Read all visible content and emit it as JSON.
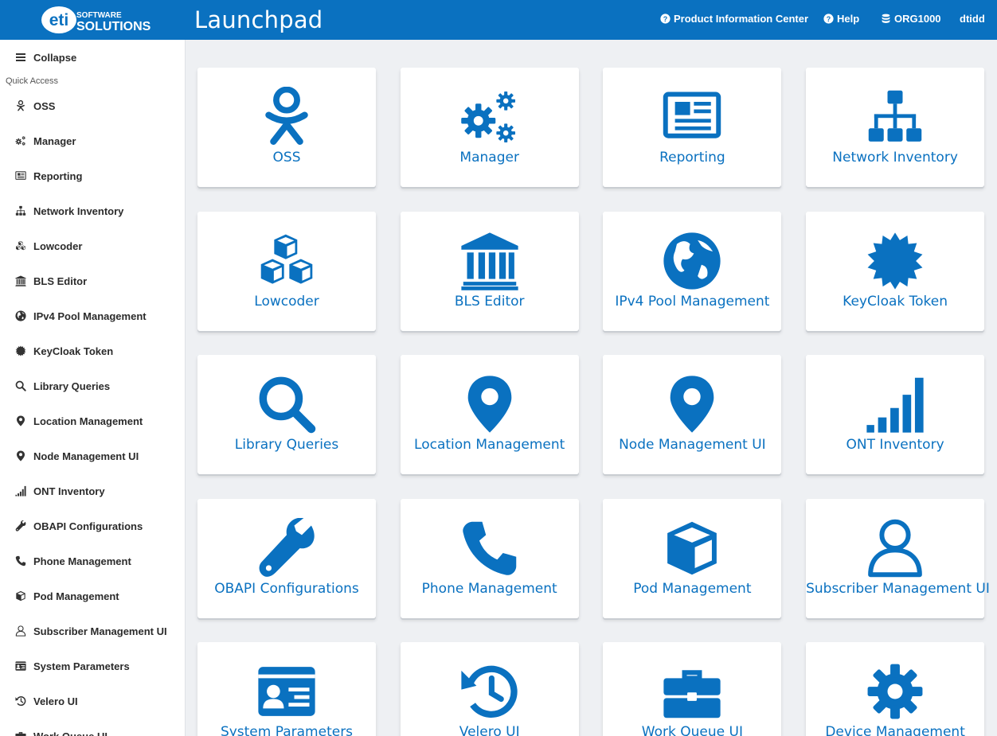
{
  "header": {
    "logo_text": "eti",
    "logo_sub1": "SOFTWARE",
    "logo_sub2": "SOLUTIONS",
    "title": "Launchpad",
    "product_info": "Product Information Center",
    "help": "Help",
    "org": "ORG1000",
    "user": "dtidd"
  },
  "sidebar": {
    "collapse": "Collapse",
    "section_label": "Quick Access",
    "items": [
      {
        "label": "OSS",
        "icon": "oss-icon"
      },
      {
        "label": "Manager",
        "icon": "gears-icon"
      },
      {
        "label": "Reporting",
        "icon": "newspaper-icon"
      },
      {
        "label": "Network Inventory",
        "icon": "sitemap-icon"
      },
      {
        "label": "Lowcoder",
        "icon": "cubes-icon"
      },
      {
        "label": "BLS Editor",
        "icon": "bank-icon"
      },
      {
        "label": "IPv4 Pool Management",
        "icon": "globe-icon"
      },
      {
        "label": "KeyCloak Token",
        "icon": "certificate-icon"
      },
      {
        "label": "Library Queries",
        "icon": "search-icon"
      },
      {
        "label": "Location Management",
        "icon": "map-marker-icon"
      },
      {
        "label": "Node Management UI",
        "icon": "map-marker-icon"
      },
      {
        "label": "ONT Inventory",
        "icon": "signal-icon"
      },
      {
        "label": "OBAPI Configurations",
        "icon": "wrench-icon"
      },
      {
        "label": "Phone Management",
        "icon": "phone-icon"
      },
      {
        "label": "Pod Management",
        "icon": "cube-icon"
      },
      {
        "label": "Subscriber Management UI",
        "icon": "user-icon"
      },
      {
        "label": "System Parameters",
        "icon": "id-card-icon"
      },
      {
        "label": "Velero UI",
        "icon": "history-icon"
      },
      {
        "label": "Work Queue UI",
        "icon": "briefcase-icon"
      }
    ]
  },
  "tiles": [
    {
      "label": "OSS",
      "icon": "oss-icon"
    },
    {
      "label": "Manager",
      "icon": "gears-icon"
    },
    {
      "label": "Reporting",
      "icon": "newspaper-icon"
    },
    {
      "label": "Network Inventory",
      "icon": "sitemap-icon"
    },
    {
      "label": "Lowcoder",
      "icon": "cubes-icon"
    },
    {
      "label": "BLS Editor",
      "icon": "bank-icon"
    },
    {
      "label": "IPv4 Pool Management",
      "icon": "globe-icon"
    },
    {
      "label": "KeyCloak Token",
      "icon": "certificate-icon"
    },
    {
      "label": "Library Queries",
      "icon": "search-icon"
    },
    {
      "label": "Location Management",
      "icon": "map-marker-icon"
    },
    {
      "label": "Node Management UI",
      "icon": "map-marker-icon"
    },
    {
      "label": "ONT Inventory",
      "icon": "signal-icon"
    },
    {
      "label": "OBAPI Configurations",
      "icon": "wrench-icon"
    },
    {
      "label": "Phone Management",
      "icon": "phone-icon"
    },
    {
      "label": "Pod Management",
      "icon": "cube-icon"
    },
    {
      "label": "Subscriber Management UI",
      "icon": "user-icon"
    },
    {
      "label": "System Parameters",
      "icon": "id-card-icon"
    },
    {
      "label": "Velero UI",
      "icon": "history-icon"
    },
    {
      "label": "Work Queue UI",
      "icon": "briefcase-icon"
    },
    {
      "label": "Device Management",
      "icon": "gear-icon"
    }
  ],
  "colors": {
    "brand_blue": "#0a71c0",
    "background": "#eef0f3",
    "tile_background": "#ffffff"
  }
}
